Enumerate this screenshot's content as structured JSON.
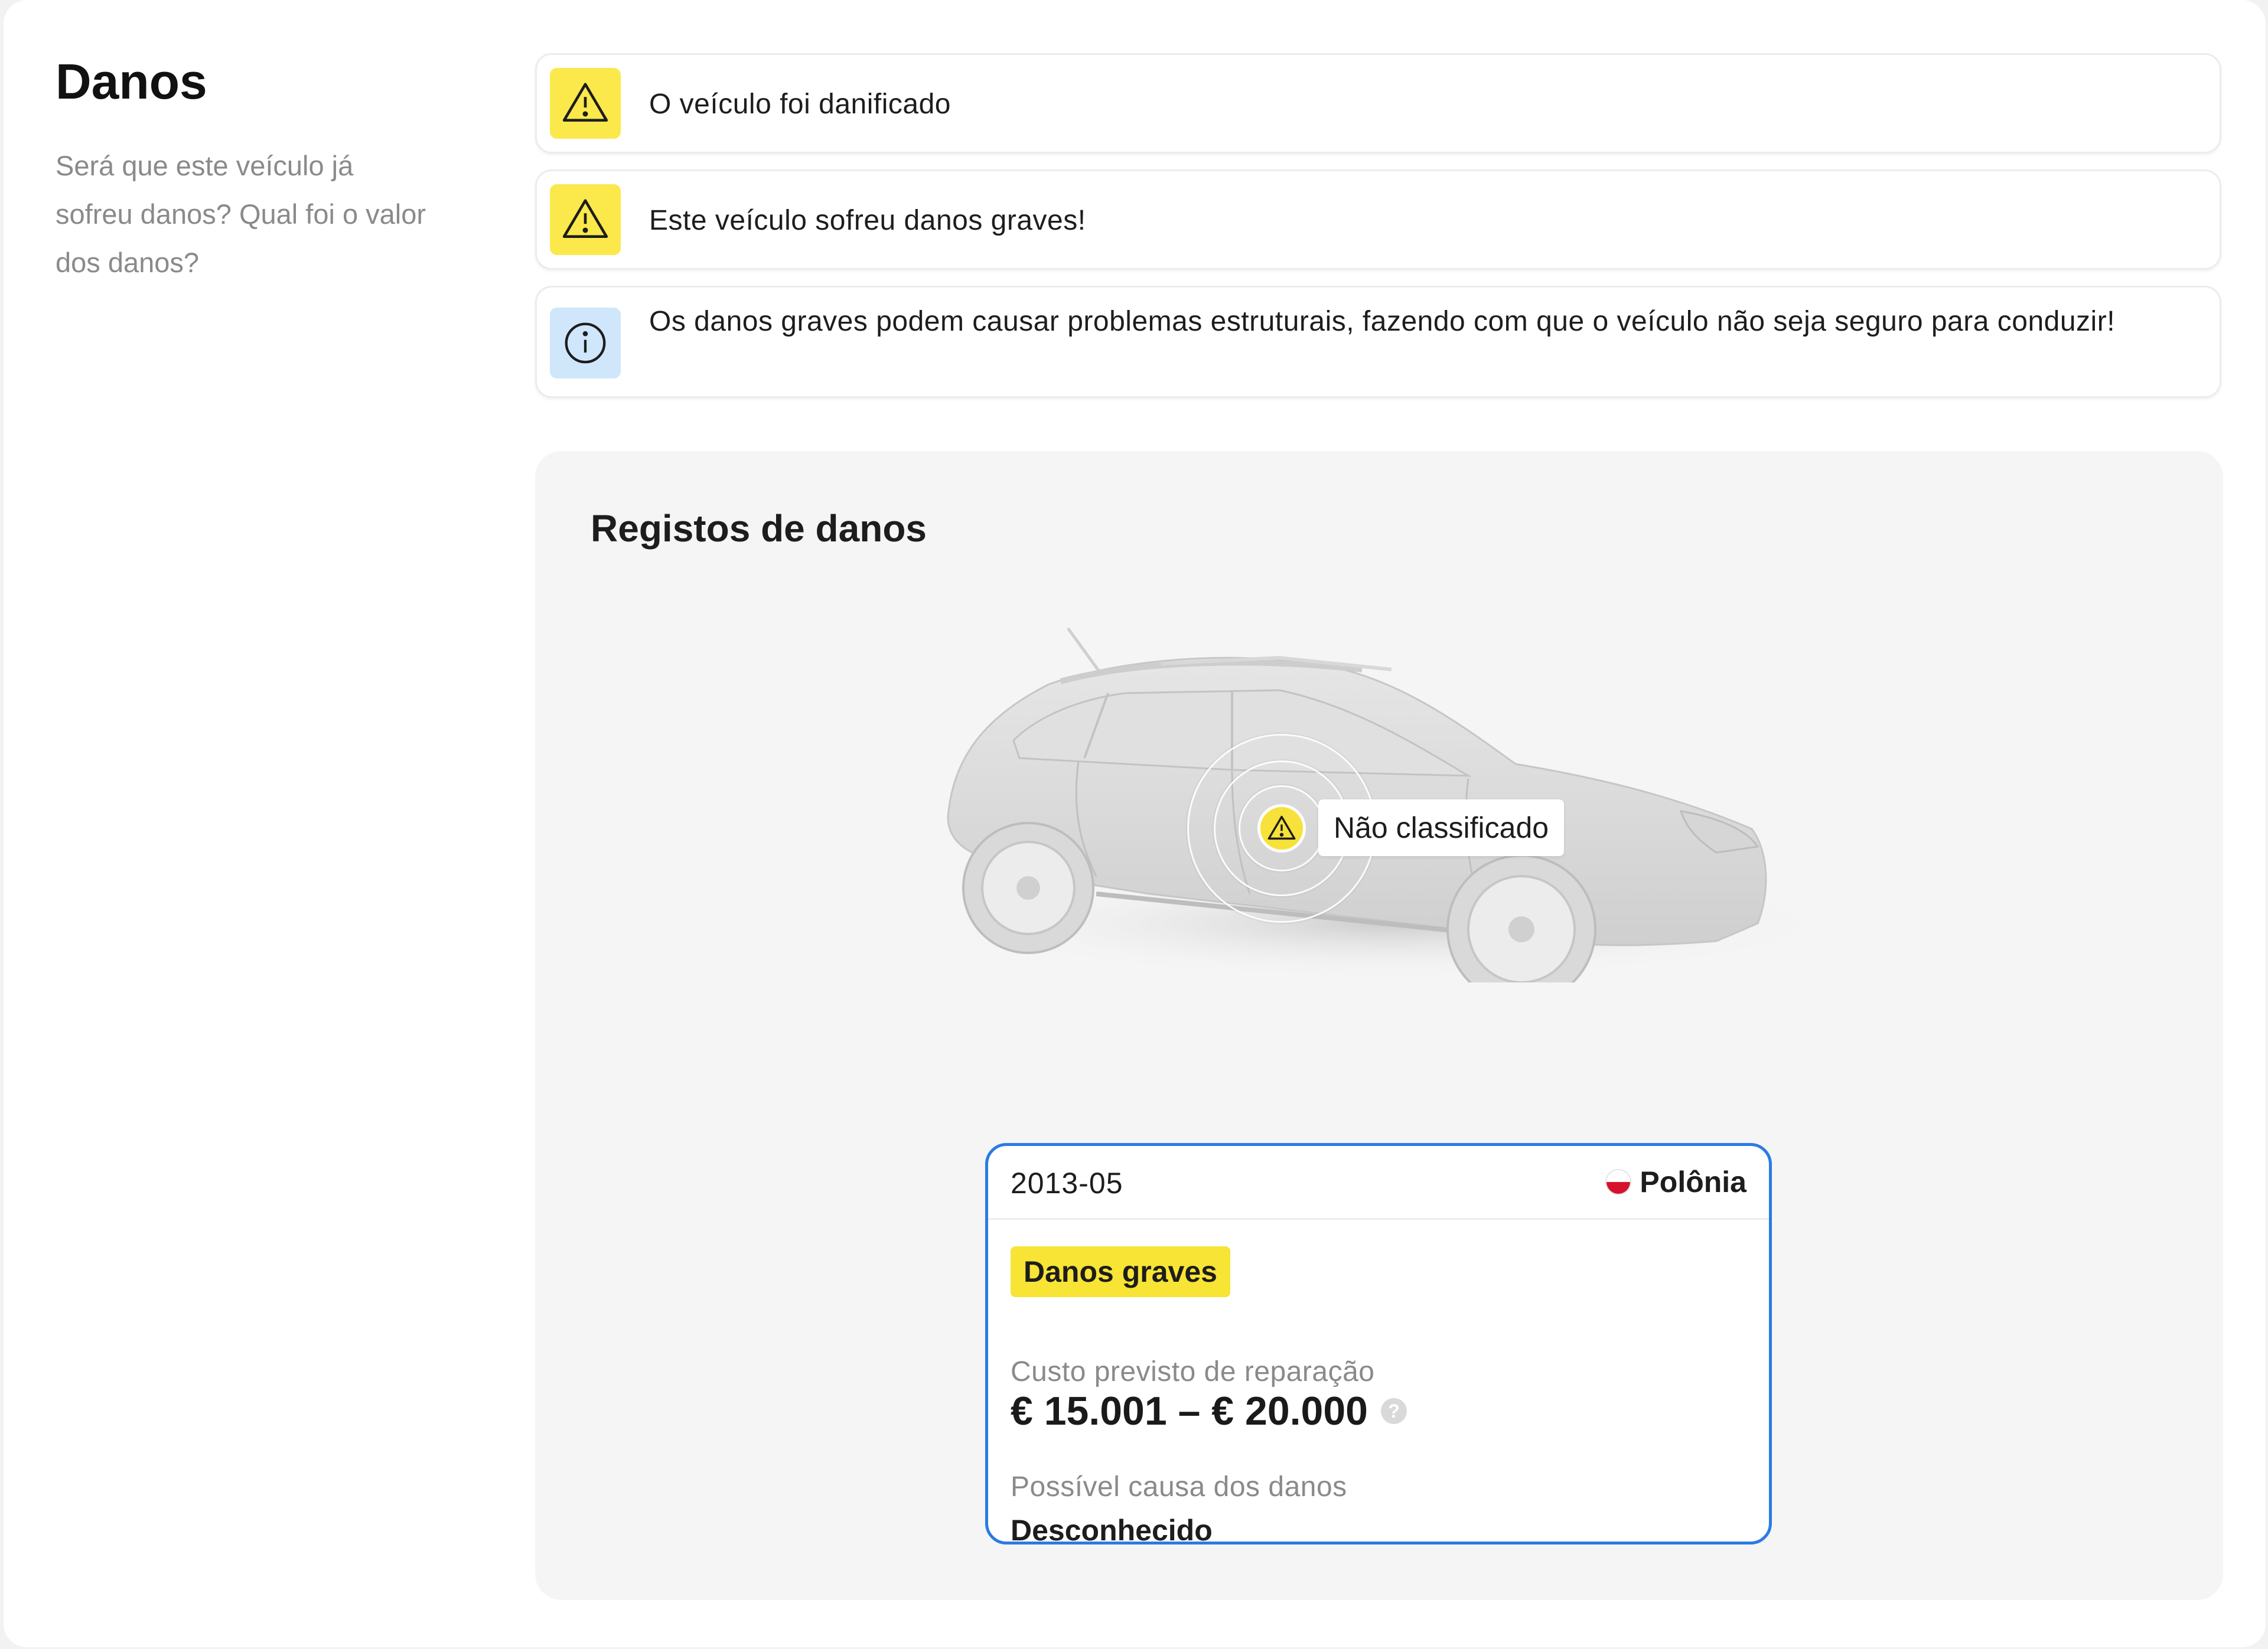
{
  "section": {
    "title": "Danos",
    "description": "Será que este veículo já sofreu danos? Qual foi o valor dos danos?"
  },
  "alerts": [
    {
      "type": "warning",
      "icon": "warning-triangle-icon",
      "text": "O veículo foi danificado"
    },
    {
      "type": "warning",
      "icon": "warning-triangle-icon",
      "text": "Este veículo sofreu danos graves!"
    },
    {
      "type": "info",
      "icon": "info-circle-icon",
      "text": "Os danos graves podem causar problemas estruturais, fazendo com que o veículo não seja seguro para conduzir!"
    }
  ],
  "records": {
    "title": "Registos de danos",
    "marker_label": "Não classificado",
    "card": {
      "date": "2013-05",
      "country": "Polônia",
      "severity": "Danos graves",
      "cost_label": "Custo previsto de reparação",
      "cost_value": "€ 15.001 – € 20.000",
      "help_symbol": "?",
      "cause_label": "Possível causa dos danos",
      "cause_value": "Desconhecido"
    }
  },
  "colors": {
    "warning": "#fbe84b",
    "info": "#cfe6fb",
    "card_border": "#2a7be4",
    "flag_red": "#d6112e"
  }
}
